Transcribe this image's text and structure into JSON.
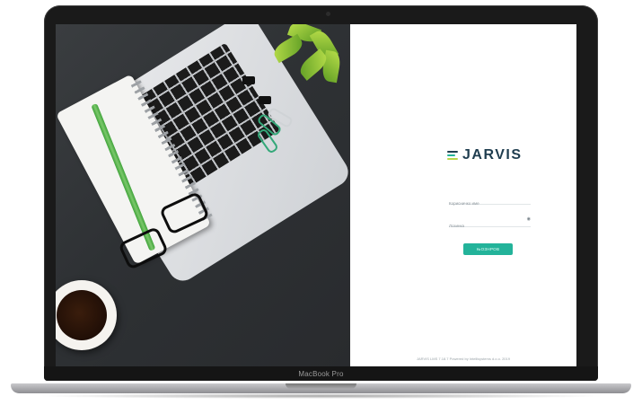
{
  "device": {
    "model_label": "MacBook Pro"
  },
  "app": {
    "brand_name": "JARVIS",
    "brand_colors": {
      "mark_top": "#1f3d4f",
      "mark_middle": "#23b39a",
      "mark_bottom": "#b9d64a",
      "text": "#1f3d4f"
    }
  },
  "login": {
    "username_placeholder": "Корисничко име",
    "password_placeholder": "Лозинка",
    "password_toggle_icon": "eye-icon",
    "submit_label": "ЊОЗНРОВ",
    "submit_color": "#23b39a"
  },
  "footer": {
    "text": "JARVIS LMS 7.18.7 Powered by Intellisystems d.o.o. 2019"
  }
}
